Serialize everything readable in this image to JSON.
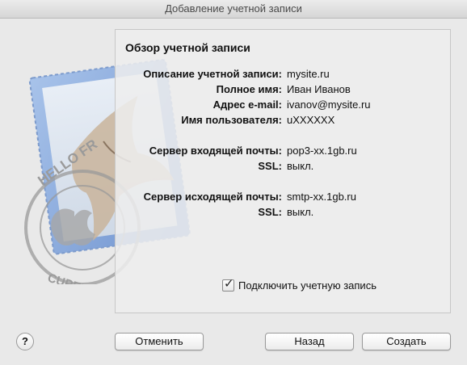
{
  "window": {
    "title": "Добавление учетной записи"
  },
  "panel": {
    "title": "Обзор учетной записи",
    "rows": [
      {
        "label": "Описание учетной записи:",
        "value": "mysite.ru"
      },
      {
        "label": "Полное имя:",
        "value": "Иван Иванов"
      },
      {
        "label": "Адрес e-mail:",
        "value": "ivanov@mysite.ru"
      },
      {
        "label": "Имя пользователя:",
        "value": "uXXXXXX"
      },
      {
        "label": "Сервер входящей почты:",
        "value": "pop3-xx.1gb.ru"
      },
      {
        "label": "SSL:",
        "value": "выкл."
      },
      {
        "label": "Сервер исходящей почты:",
        "value": "smtp-xx.1gb.ru"
      },
      {
        "label": "SSL:",
        "value": "выкл."
      }
    ],
    "activate_checkbox": {
      "label": "Подключить учетную запись",
      "checked": true
    }
  },
  "stamp": {
    "text_top": "HELLO FR",
    "text_bottom": "CUPERTINO, CA"
  },
  "buttons": {
    "help": "?",
    "cancel": "Отменить",
    "back": "Назад",
    "create": "Создать"
  }
}
